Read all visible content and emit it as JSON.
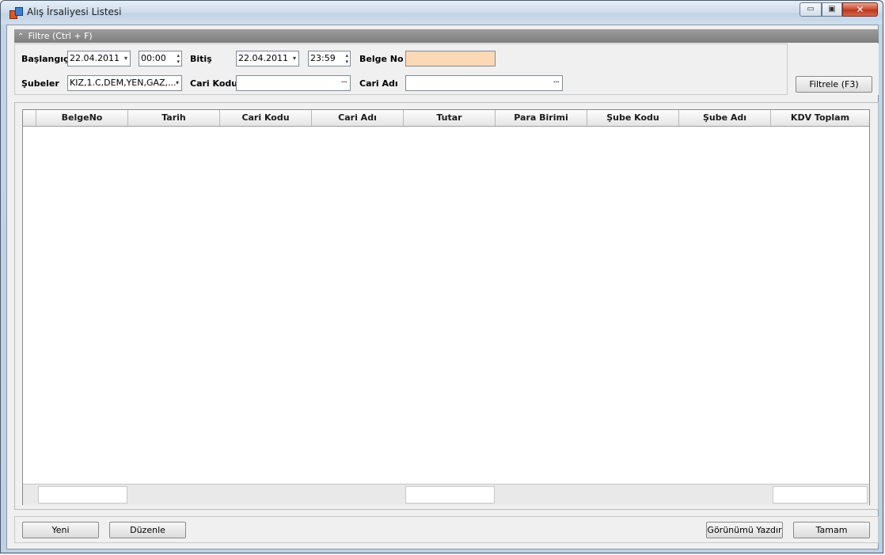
{
  "window": {
    "title": "Alış İrsaliyesi Listesi",
    "minimize_glyph": "▭",
    "maximize_glyph": "▣",
    "close_glyph": "✕"
  },
  "filter": {
    "header_label": "Filtre (Ctrl + F)",
    "collapse_glyph": "⌃",
    "start_label": "Başlangıç",
    "start_date": "22.04.2011",
    "start_time": "00:00",
    "end_label": "Bitiş",
    "end_date": "22.04.2011",
    "end_time": "23:59",
    "doc_no_label": "Belge No",
    "doc_no_value": "",
    "branches_label": "Şubeler",
    "branches_value": "KIZ,1.C,DEM,YEN,GAZ,...",
    "account_code_label": "Cari Kodu",
    "account_code_value": "",
    "account_name_label": "Cari Adı",
    "account_name_value": "",
    "ellipsis": "···",
    "dropdown_glyph": "▾",
    "spin_glyph_up": "▴",
    "spin_glyph_down": "▾",
    "apply_button": "Filtrele (F3)"
  },
  "grid": {
    "columns": [
      "BelgeNo",
      "Tarih",
      "Cari Kodu",
      "Cari Adı",
      "Tutar",
      "Para Birimi",
      "Şube Kodu",
      "Şube Adı",
      "KDV Toplam"
    ],
    "rows": []
  },
  "actions": {
    "new": "Yeni",
    "edit": "Düzenle",
    "print_view": "Görünümü Yazdır",
    "ok": "Tamam"
  },
  "colors": {
    "doc_no_field_bg": "#fcd9b6",
    "close_button": "#c94a2e"
  }
}
